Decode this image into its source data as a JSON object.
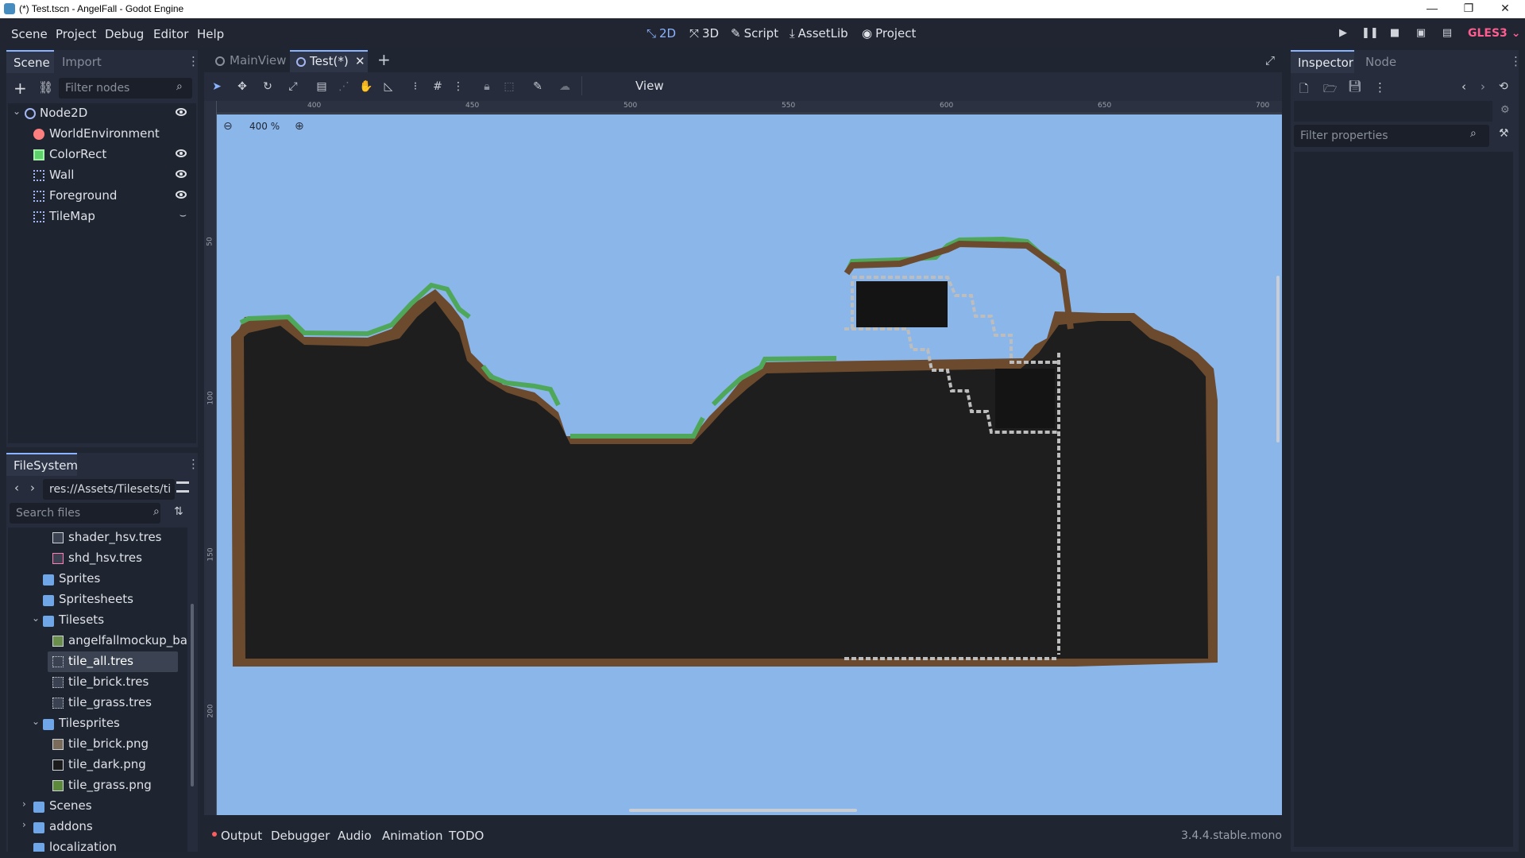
{
  "window": {
    "title": "(*) Test.tscn - AngelFall - Godot Engine",
    "min": "—",
    "max": "❐",
    "close": "✕"
  },
  "menu": [
    "Scene",
    "Project",
    "Debug",
    "Editor",
    "Help"
  ],
  "workspaces": [
    {
      "label": "2D",
      "icon": "2d-icon"
    },
    {
      "label": "3D",
      "icon": "3d-icon"
    },
    {
      "label": "Script",
      "icon": "script-icon"
    },
    {
      "label": "AssetLib",
      "icon": "assetlib-icon"
    },
    {
      "label": "Project",
      "icon": "project-icon"
    }
  ],
  "renderer": "GLES3",
  "scene_dock": {
    "tabs": [
      "Scene",
      "Import"
    ],
    "filter_placeholder": "Filter nodes",
    "nodes": [
      {
        "label": "Node2D",
        "icon": "node2d-icon",
        "color": "#a5b7f3"
      },
      {
        "label": "WorldEnvironment",
        "icon": "world-environment-icon",
        "color": "#fc7f7f"
      },
      {
        "label": "ColorRect",
        "icon": "color-rect-icon",
        "color": "#a5efac"
      },
      {
        "label": "Wall",
        "icon": "tilemap-icon",
        "color": "#a5b7f3"
      },
      {
        "label": "Foreground",
        "icon": "tilemap-icon",
        "color": "#a5b7f3"
      },
      {
        "label": "TileMap",
        "icon": "tilemap-icon",
        "color": "#a5b7f3"
      }
    ]
  },
  "filesystem": {
    "title": "FileSystem",
    "path": "res://Assets/Tilesets/ti",
    "search_placeholder": "Search files",
    "items": [
      {
        "label": "shader_hsv.tres",
        "type": "file"
      },
      {
        "label": "shd_hsv.tres",
        "type": "file"
      },
      {
        "label": "Sprites",
        "type": "folder"
      },
      {
        "label": "Spritesheets",
        "type": "folder"
      },
      {
        "label": "Tilesets",
        "type": "folder"
      },
      {
        "label": "angelfallmockup_bac",
        "type": "image"
      },
      {
        "label": "tile_all.tres",
        "type": "tileset"
      },
      {
        "label": "tile_brick.tres",
        "type": "tileset"
      },
      {
        "label": "tile_grass.tres",
        "type": "tileset"
      },
      {
        "label": "Tilesprites",
        "type": "folder"
      },
      {
        "label": "tile_brick.png",
        "type": "image"
      },
      {
        "label": "tile_dark.png",
        "type": "image"
      },
      {
        "label": "tile_grass.png",
        "type": "image"
      },
      {
        "label": "Scenes",
        "type": "folder"
      },
      {
        "label": "addons",
        "type": "folder"
      },
      {
        "label": "localization",
        "type": "folder"
      }
    ]
  },
  "editor_tabs": [
    "MainView",
    "Test(*)"
  ],
  "toolbar": {
    "view_label": "View"
  },
  "viewport": {
    "zoom": "400 %",
    "ruler_top": [
      "400",
      "450",
      "500",
      "550",
      "600",
      "650",
      "700"
    ],
    "ruler_left": [
      "50",
      "100",
      "150",
      "200"
    ],
    "colors": {
      "sky": "#8ab6ea",
      "ground": "#1e1e1e",
      "dirt": "#6b4a2e",
      "grass": "#4fa85a",
      "brick": "#bdbdbd"
    }
  },
  "inspector": {
    "tabs": [
      "Inspector",
      "Node"
    ],
    "filter_placeholder": "Filter properties"
  },
  "bottom_panel": {
    "tabs": [
      "Output",
      "Debugger",
      "Audio",
      "Animation",
      "TODO"
    ],
    "version": "3.4.4.stable.mono"
  }
}
